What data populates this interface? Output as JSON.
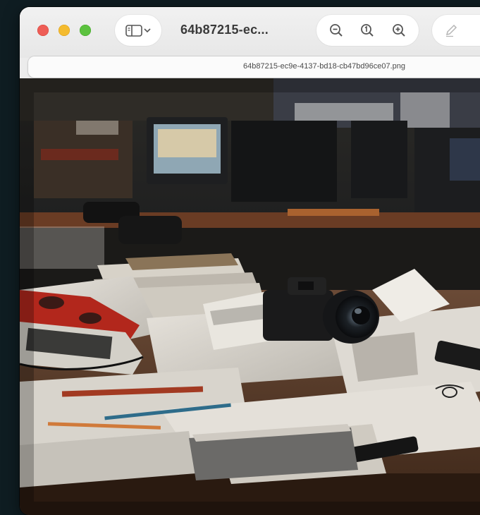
{
  "window": {
    "title": "64b87215-ec...",
    "filename": "64b87215-ec9e-4137-bd18-cb47bd96ce07.png"
  },
  "toolbar": {
    "icons": [
      "sidebar-toggle-icon",
      "chevron-down-icon",
      "zoom-out-icon",
      "actual-size-icon",
      "zoom-in-icon",
      "markup-pencil-icon"
    ]
  },
  "colors": {
    "close": "#ee5d56",
    "minimize": "#f4bb2f",
    "zoom": "#5cc23f",
    "desktop_background": "#0f1d22"
  }
}
